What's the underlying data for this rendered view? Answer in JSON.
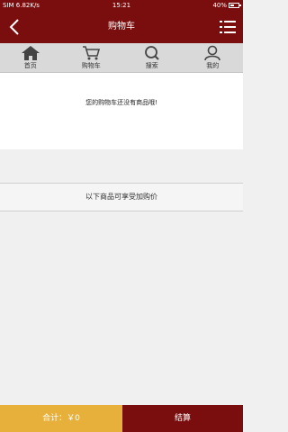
{
  "status_bar": {
    "left": "SIM 6.82K/s",
    "time": "15:21",
    "battery": "40%"
  },
  "nav": {
    "title": "购物车",
    "back_icon": "chevron-left-icon",
    "menu_icon": "list-icon"
  },
  "tabs": [
    {
      "label": "首页",
      "icon": "home-icon"
    },
    {
      "label": "购物车",
      "icon": "cart-icon"
    },
    {
      "label": "搜索",
      "icon": "search-icon"
    },
    {
      "label": "我的",
      "icon": "user-icon"
    }
  ],
  "cart": {
    "empty_message": "您的购物车还没有商品哦!"
  },
  "promo": {
    "text": "以下商品可享受加购价"
  },
  "footer": {
    "total": "合计：￥0",
    "checkout": "结算"
  },
  "colors": {
    "primary": "#7a0e0e",
    "accent": "#e6b03a"
  }
}
